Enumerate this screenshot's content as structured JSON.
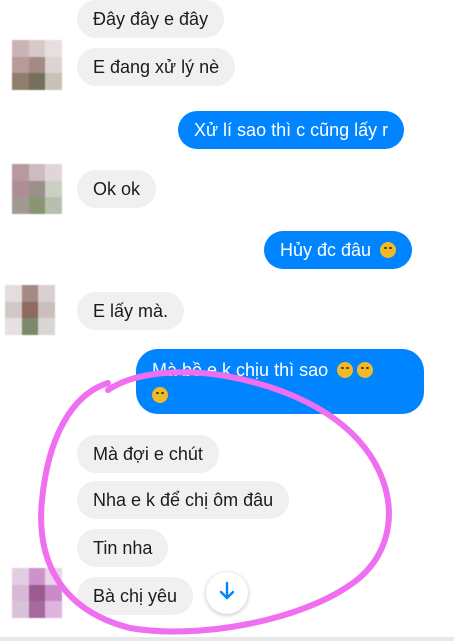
{
  "conversation": {
    "messages": [
      {
        "side": "incoming",
        "text": "Đây đây e đây"
      },
      {
        "side": "incoming",
        "text": "E đang xử lý nè"
      },
      {
        "side": "outgoing",
        "text": "Xử lí sao thì c cũng lấy r"
      },
      {
        "side": "incoming",
        "text": "Ok ok"
      },
      {
        "side": "outgoing",
        "text": "Hủy đc đâu",
        "emoji": "disappointed-face"
      },
      {
        "side": "incoming",
        "text": "E lấy mà."
      },
      {
        "side": "outgoing",
        "text": "Mà bồ e k chịu thì sao",
        "emoji": "sad-face x3"
      },
      {
        "side": "incoming",
        "text": "Mà đợi e chút"
      },
      {
        "side": "incoming",
        "text": "Nha e k để chị ôm đâu"
      },
      {
        "side": "incoming",
        "text": "Tin nha"
      },
      {
        "side": "incoming",
        "text": "Bà chị yêu"
      }
    ]
  },
  "colors": {
    "outgoing_bubble": "#0084ff",
    "incoming_bubble": "#f1f0f0",
    "highlight_circle": "#f06ef0",
    "scroll_arrow": "#0084ff"
  },
  "icons": {
    "scroll_down": "arrow-down-icon",
    "avatar": "blurred-avatar"
  }
}
